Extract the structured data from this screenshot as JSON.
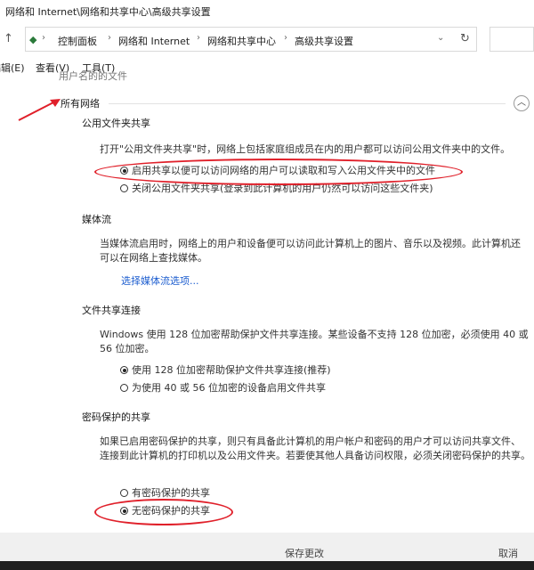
{
  "window": {
    "title": "网络和 Internet\\网络和共享中心\\高级共享设置"
  },
  "address": {
    "breadcrumbs": [
      "控制面板",
      "网络和 Internet",
      "网络和共享中心",
      "高级共享设置"
    ],
    "refresh_icon": "refresh-icon",
    "dropdown_icon": "chevron-down-icon"
  },
  "menu": {
    "items": [
      "编辑(E)",
      "查看(V)",
      "工具(T)"
    ]
  },
  "top_partial": "用户名的的文件",
  "all_networks": {
    "title": "所有网络"
  },
  "public_folder": {
    "title": "公用文件夹共享",
    "description": "打开\"公用文件夹共享\"时，网络上包括家庭组成员在内的用户都可以访问公用文件夹中的文件。",
    "options": [
      {
        "label": "启用共享以便可以访问网络的用户可以读取和写入公用文件夹中的文件",
        "selected": true
      },
      {
        "label": "关闭公用文件夹共享(登录到此计算机的用户仍然可以访问这些文件夹)",
        "selected": false
      }
    ]
  },
  "media": {
    "title": "媒体流",
    "description_line1": "当媒体流启用时，网络上的用户和设备便可以访问此计算机上的图片、音乐以及视频。此计算机还",
    "description_line2": "可以在网络上查找媒体。",
    "link": "选择媒体流选项..."
  },
  "file_sharing": {
    "title": "文件共享连接",
    "description_line1": "Windows 使用 128 位加密帮助保护文件共享连接。某些设备不支持 128 位加密，必须使用 40 或",
    "description_line2": "56 位加密。",
    "options": [
      {
        "label": "使用 128 位加密帮助保护文件共享连接(推荐)",
        "selected": true
      },
      {
        "label": "为使用 40 或 56 位加密的设备启用文件共享",
        "selected": false
      }
    ]
  },
  "password": {
    "title": "密码保护的共享",
    "description_line1": "如果已启用密码保护的共享，则只有具备此计算机的用户帐户和密码的用户才可以访问共享文件、",
    "description_line2": "连接到此计算机的打印机以及公用文件夹。若要使其他人具备访问权限，必须关闭密码保护的共享。",
    "options": [
      {
        "label": "有密码保护的共享",
        "selected": false
      },
      {
        "label": "无密码保护的共享",
        "selected": true
      }
    ]
  },
  "footer": {
    "save": "保存更改",
    "cancel": "取消"
  },
  "colors": {
    "annotation": "#e0202a",
    "link": "#1b5ccf"
  }
}
